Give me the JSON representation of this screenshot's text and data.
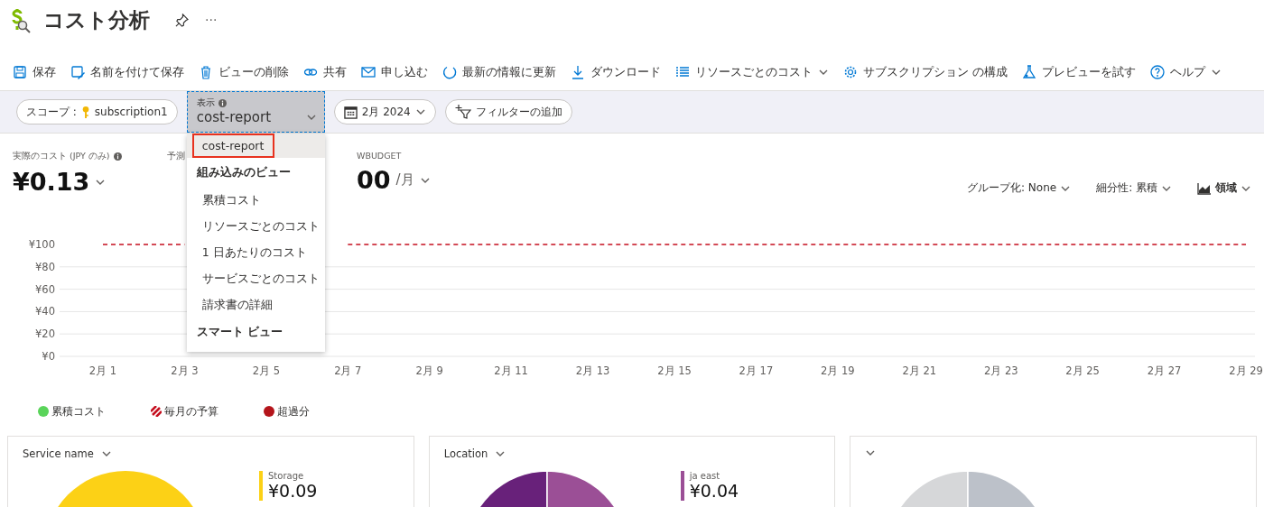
{
  "header": {
    "title": "コスト分析",
    "more": "···"
  },
  "toolbar": [
    {
      "label": "保存",
      "dropdown": false
    },
    {
      "label": "名前を付けて保存",
      "dropdown": false
    },
    {
      "label": "ビューの削除",
      "dropdown": false
    },
    {
      "label": "共有",
      "dropdown": false
    },
    {
      "label": "申し込む",
      "dropdown": false
    },
    {
      "label": "最新の情報に更新",
      "dropdown": false
    },
    {
      "label": "ダウンロード",
      "dropdown": false
    },
    {
      "label": "リソースごとのコスト",
      "dropdown": true
    },
    {
      "label": "サブスクリプション の構成",
      "dropdown": false
    },
    {
      "label": "プレビューを試す",
      "dropdown": false
    },
    {
      "label": "ヘルプ",
      "dropdown": true
    }
  ],
  "filter_bar": {
    "scope": {
      "label": "スコープ :",
      "value": "subscription1"
    },
    "view": {
      "label": "表示",
      "value": "cost-report",
      "expanded": true
    },
    "date": "2月 2024",
    "add_filter": "フィルターの追加"
  },
  "view_menu": [
    {
      "kind": "item",
      "label": "cost-report",
      "selected": true
    },
    {
      "kind": "header",
      "label": "組み込みのビュー"
    },
    {
      "kind": "item",
      "label": "累積コスト",
      "selected": false
    },
    {
      "kind": "item",
      "label": "リソースごとのコスト",
      "selected": false
    },
    {
      "kind": "item",
      "label": "1 日あたりのコスト",
      "selected": false
    },
    {
      "kind": "item",
      "label": "サービスごとのコスト",
      "selected": false
    },
    {
      "kind": "item",
      "label": "請求書の詳細",
      "selected": false
    },
    {
      "kind": "header",
      "label": "スマート ビュー"
    }
  ],
  "kpis": {
    "actual": {
      "label": "実際のコスト (JPY のみ)",
      "value": "¥0.13"
    },
    "forecast": {
      "label": "予測"
    },
    "budget": {
      "label": "WBUDGET",
      "value": "00",
      "unit": "/月"
    }
  },
  "chart_controls": [
    {
      "kind": "text",
      "label": "グループ化:",
      "value": "None"
    },
    {
      "kind": "text",
      "label": "細分性:",
      "value": "累積"
    },
    {
      "kind": "icon",
      "value": "領域"
    }
  ],
  "chart_data": {
    "type": "line",
    "categories": [
      "2月 1",
      "2月 3",
      "2月 5",
      "2月 7",
      "2月 9",
      "2月 11",
      "2月 13",
      "2月 15",
      "2月 17",
      "2月 19",
      "2月 21",
      "2月 23",
      "2月 25",
      "2月 27",
      "2月 29"
    ],
    "series": [
      {
        "name": "毎月の予算",
        "color": "#c50f1f",
        "line_style": "dashed",
        "values": [
          100,
          100,
          null,
          100,
          100,
          100,
          100,
          100,
          100,
          100,
          100,
          100,
          100,
          100,
          100
        ]
      }
    ],
    "grid": true,
    "ylim": [
      0,
      100
    ],
    "yticks": [
      {
        "value": 0,
        "label": "¥0"
      },
      {
        "value": 20,
        "label": "¥20"
      },
      {
        "value": 40,
        "label": "¥40"
      },
      {
        "value": 60,
        "label": "¥60"
      },
      {
        "value": 80,
        "label": "¥80"
      },
      {
        "value": 100,
        "label": "¥100"
      }
    ]
  },
  "legend": [
    {
      "kind": "dot",
      "label": "累積コスト",
      "color": "#5ad45a"
    },
    {
      "kind": "series"
    },
    {
      "kind": "dot",
      "label": "超過分",
      "color": "#b4151b"
    }
  ],
  "cards": [
    {
      "title": "Service name",
      "slices": [
        {
          "color": "#fcd116"
        }
      ],
      "legend": {
        "label": "Storage",
        "value": "¥0.09",
        "color": "#fcd116"
      }
    },
    {
      "title": "Location",
      "slices": [
        {
          "color": "#68217a"
        },
        {
          "color": "#9b4f96"
        }
      ],
      "legend": {
        "label": "ja east",
        "value": "¥0.04",
        "color": "#9b4f96"
      }
    },
    {
      "slices": [
        {
          "color": "#d6d7d9"
        },
        {
          "color": "#bcc1c9"
        }
      ]
    }
  ]
}
